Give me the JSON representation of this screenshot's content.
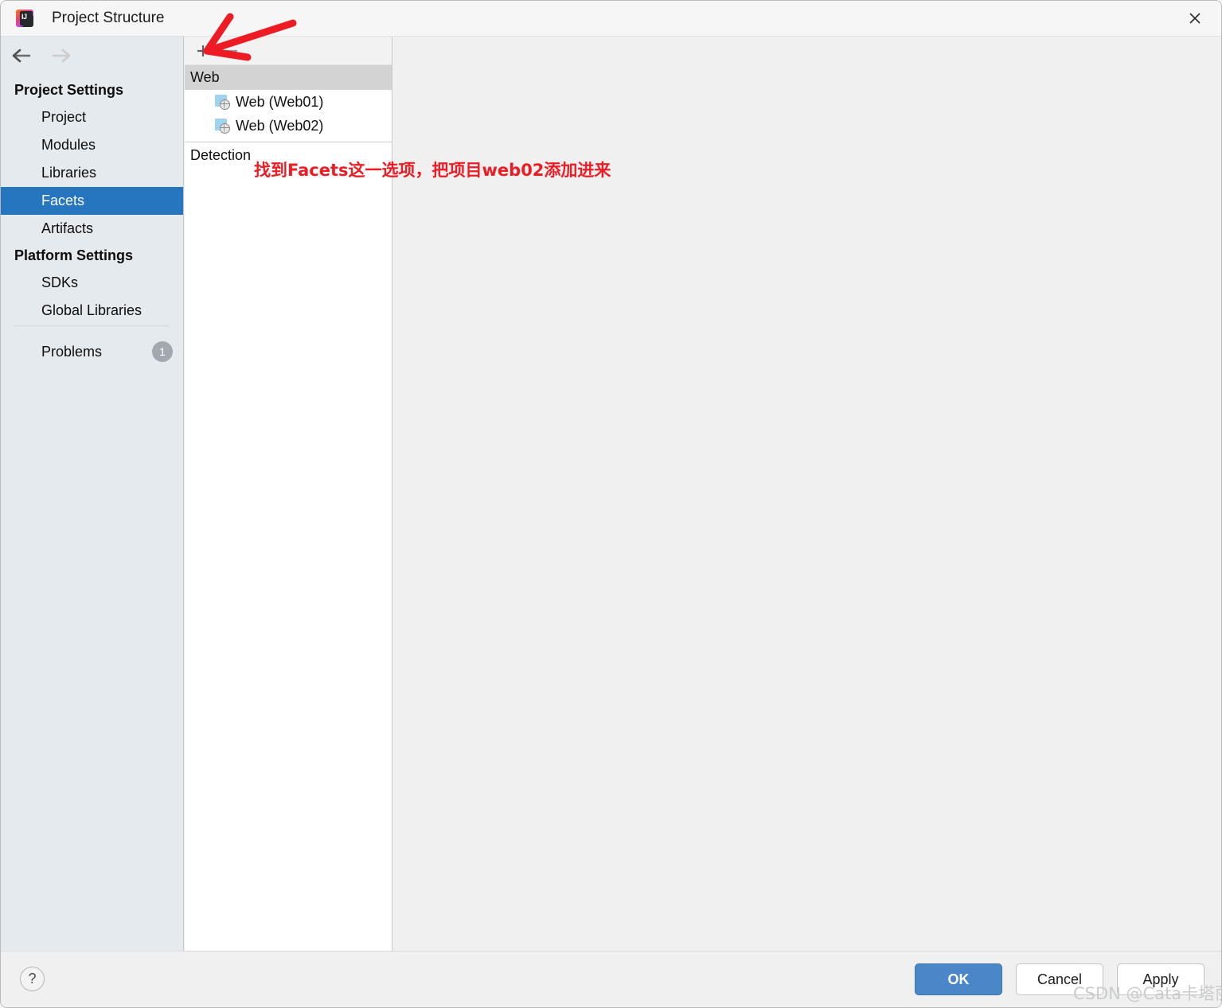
{
  "window": {
    "title": "Project Structure",
    "app_icon": "intellij-idea-icon",
    "icon_text": "IJ",
    "close_icon": "close-icon"
  },
  "sidebar": {
    "back_icon": "arrow-left-icon",
    "forward_icon": "arrow-right-icon",
    "groups": [
      {
        "label": "Project Settings",
        "items": [
          {
            "label": "Project",
            "selected": false
          },
          {
            "label": "Modules",
            "selected": false
          },
          {
            "label": "Libraries",
            "selected": false
          },
          {
            "label": "Facets",
            "selected": true
          },
          {
            "label": "Artifacts",
            "selected": false
          }
        ]
      },
      {
        "label": "Platform Settings",
        "items": [
          {
            "label": "SDKs",
            "selected": false
          },
          {
            "label": "Global Libraries",
            "selected": false
          }
        ]
      }
    ],
    "problems": {
      "label": "Problems",
      "count": "1"
    }
  },
  "tree_panel": {
    "toolbar": {
      "add_label": "+",
      "add_icon": "plus-icon",
      "remove_label": "−",
      "remove_icon": "minus-icon"
    },
    "group": {
      "label": "Web",
      "items": [
        {
          "label": "Web (Web01)",
          "icon": "web-facet-icon"
        },
        {
          "label": "Web (Web02)",
          "icon": "web-facet-icon"
        }
      ]
    },
    "section": {
      "label": "Detection"
    }
  },
  "footer": {
    "help_label": "?",
    "help_icon": "help-icon",
    "buttons": [
      {
        "label": "OK",
        "primary": true
      },
      {
        "label": "Cancel",
        "primary": false
      },
      {
        "label": "Apply",
        "primary": false
      }
    ]
  },
  "annotations": {
    "arrow": "red-arrow-pointing-to-add-button",
    "text": "找到Facets这一选项，把项目web02添加进来",
    "watermark": "CSDN @Cata卡塔丽娜"
  },
  "colors": {
    "accent_selected": "#2675bf",
    "primary_button": "#4a86c8",
    "annotation_red": "#ed1c24",
    "sidebar_bg": "#e5eaee",
    "tree_group_bg": "#d3d3d3"
  }
}
